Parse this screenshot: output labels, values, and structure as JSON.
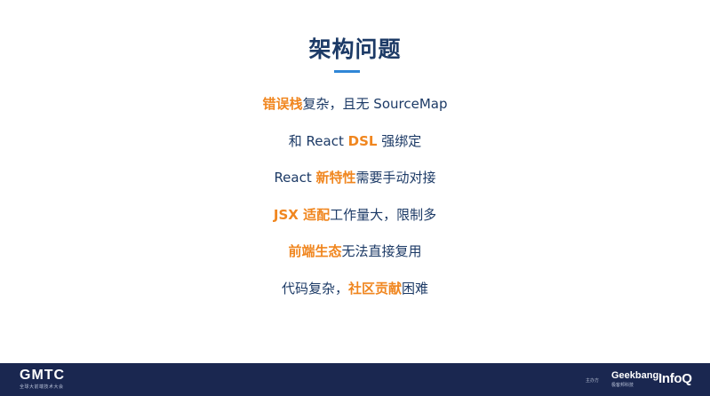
{
  "slide": {
    "title": "架构问题",
    "accent_color": "#f0861f",
    "text_color": "#1c3a66",
    "underline_color": "#2f86d6",
    "bullets": [
      [
        {
          "t": "错误栈",
          "hl": true
        },
        {
          "t": "复杂，且无 SourceMap",
          "hl": false
        }
      ],
      [
        {
          "t": "和 React ",
          "hl": false
        },
        {
          "t": "DSL",
          "hl": true
        },
        {
          "t": " 强绑定",
          "hl": false
        }
      ],
      [
        {
          "t": "React ",
          "hl": false
        },
        {
          "t": "新特性",
          "hl": true
        },
        {
          "t": "需要手动对接",
          "hl": false
        }
      ],
      [
        {
          "t": "JSX 适配",
          "hl": true
        },
        {
          "t": "工作量大，限制多",
          "hl": false
        }
      ],
      [
        {
          "t": "前端生态",
          "hl": true
        },
        {
          "t": "无法直接复用",
          "hl": false
        }
      ],
      [
        {
          "t": "代码复杂，",
          "hl": false
        },
        {
          "t": "社区贡献",
          "hl": true
        },
        {
          "t": "困难",
          "hl": false
        }
      ]
    ]
  },
  "footer": {
    "background": "#1a2750",
    "left_logo": "GMTC",
    "left_logo_subtitle": "全球大前端技术大会",
    "host_label": "主办方",
    "geekbang": "Geekbang›",
    "geekbang_subtitle": "极客邦科技",
    "infoq": "InfoQ"
  }
}
